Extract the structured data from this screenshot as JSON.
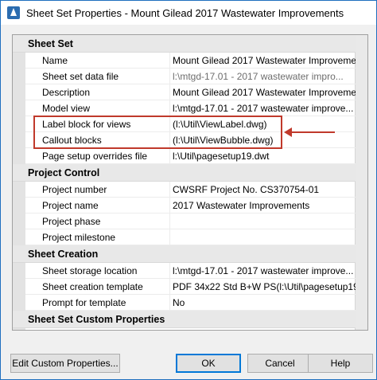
{
  "window": {
    "title": "Sheet Set Properties - Mount Gilead 2017 Wastewater Improvements"
  },
  "categories": [
    {
      "label": "Sheet Set",
      "rows": [
        {
          "name": "Name",
          "value": "Mount Gilead 2017 Wastewater Improveme..."
        },
        {
          "name": "Sheet set data file",
          "value": "l:\\mtgd-17.01 - 2017 wastewater impro..."
        },
        {
          "name": "Description",
          "value": "Mount Gilead 2017 Wastewater Improveme..."
        },
        {
          "name": "Model view",
          "value": "l:\\mtgd-17.01 - 2017 wastewater improve..."
        },
        {
          "name": "Label block for views",
          "value": "(l:\\Util\\ViewLabel.dwg)"
        },
        {
          "name": "Callout blocks",
          "value": "(l:\\Util\\ViewBubble.dwg)"
        },
        {
          "name": "Page setup overrides file",
          "value": "l:\\Util\\pagesetup19.dwt"
        }
      ]
    },
    {
      "label": "Project Control",
      "rows": [
        {
          "name": "Project number",
          "value": "CWSRF Project No. CS370754-01"
        },
        {
          "name": "Project name",
          "value": "2017 Wastewater Improvements"
        },
        {
          "name": "Project phase",
          "value": ""
        },
        {
          "name": "Project milestone",
          "value": ""
        }
      ]
    },
    {
      "label": "Sheet Creation",
      "rows": [
        {
          "name": "Sheet storage location",
          "value": "l:\\mtgd-17.01 - 2017 wastewater improve..."
        },
        {
          "name": "Sheet creation template",
          "value": "PDF 34x22 Std B+W PS(l:\\Util\\pagesetup19..."
        },
        {
          "name": "Prompt for template",
          "value": "No"
        }
      ]
    },
    {
      "label": "Sheet Set Custom Properties",
      "rows": []
    }
  ],
  "buttons": {
    "edit_custom": "Edit Custom Properties...",
    "ok": "OK",
    "cancel": "Cancel",
    "help": "Help"
  },
  "colors": {
    "annotation": "#c0392b",
    "accent": "#0078d7"
  },
  "icons": {
    "app": "autocad-icon"
  }
}
